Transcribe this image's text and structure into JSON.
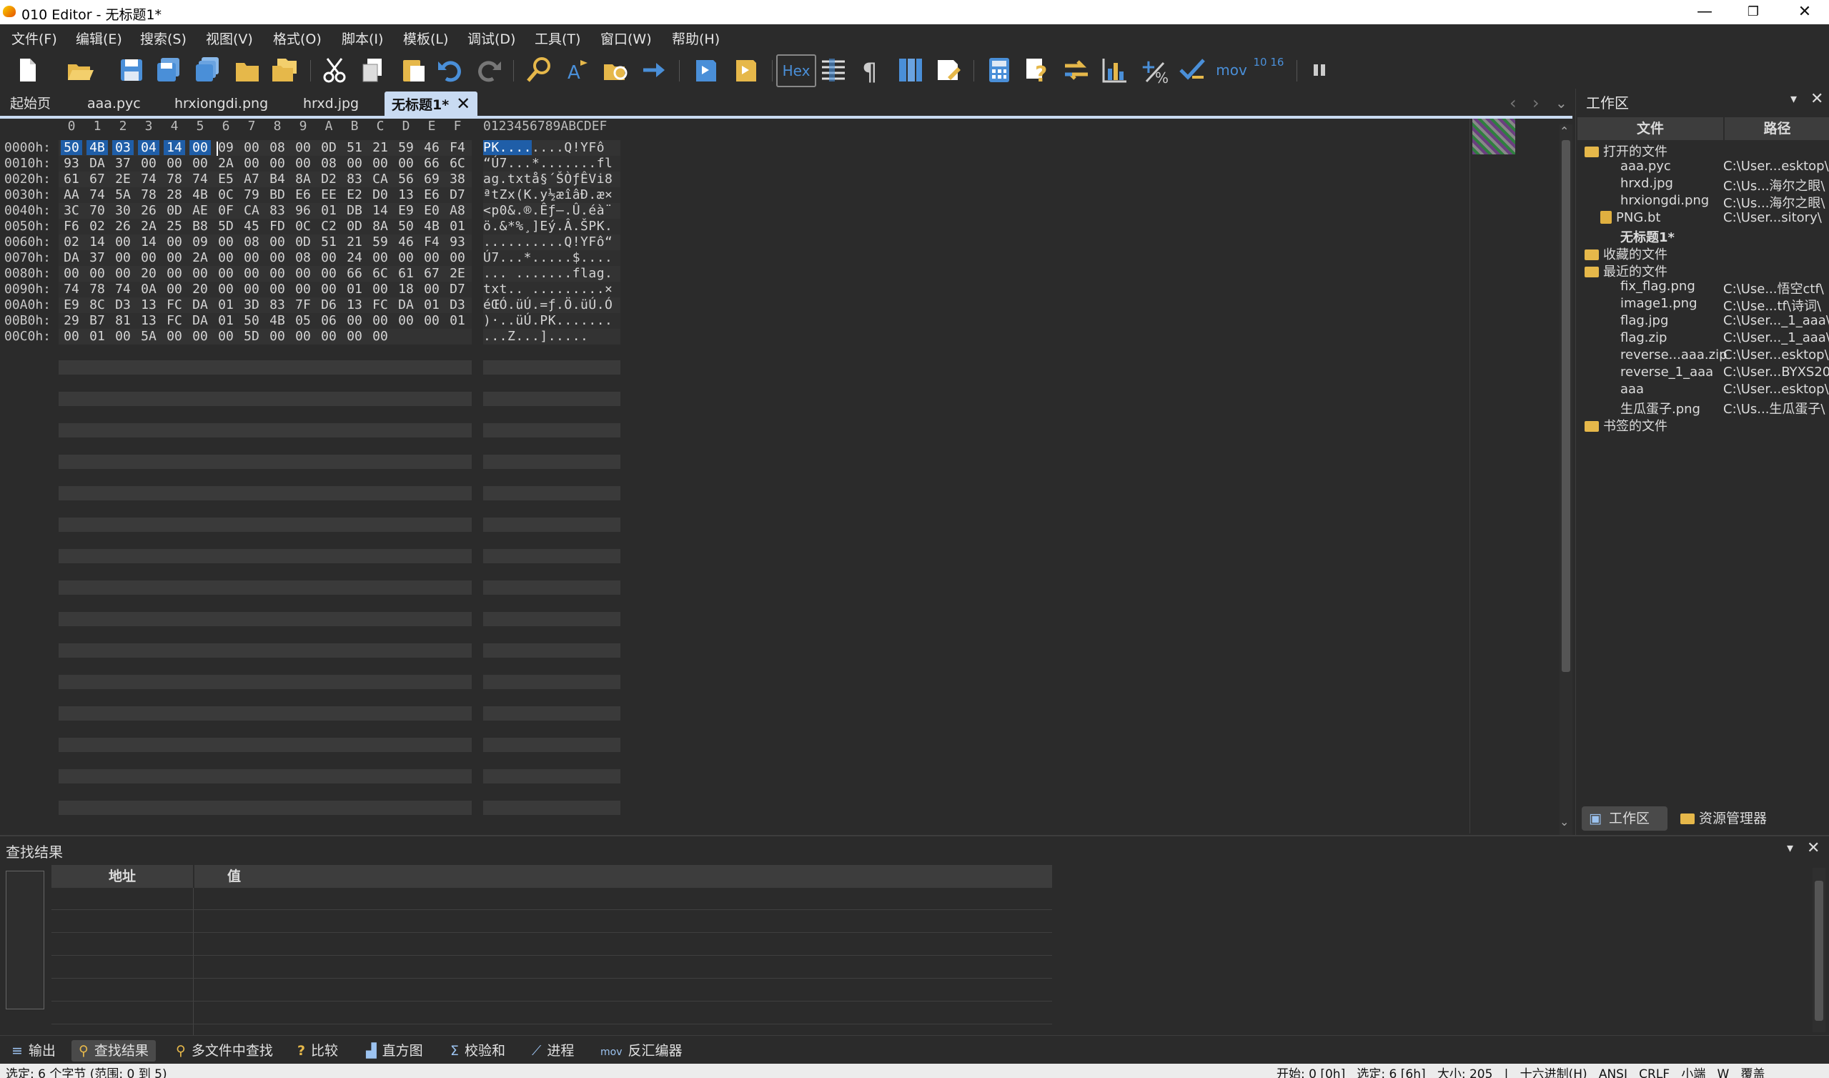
{
  "window": {
    "title": "010 Editor - 无标题1*",
    "minimize": "—",
    "maximize": "❐",
    "close": "✕"
  },
  "menu": [
    "文件(F)",
    "编辑(E)",
    "搜索(S)",
    "视图(V)",
    "格式(O)",
    "脚本(I)",
    "模板(L)",
    "调试(D)",
    "工具(T)",
    "窗口(W)",
    "帮助(H)"
  ],
  "toolbar": {
    "hex_label": "Hex",
    "mov_label": "mov",
    "base_label": "10 16"
  },
  "tabs": [
    "起始页",
    "aaa.pyc",
    "hrxiongdi.png",
    "hrxd.jpg",
    "无标题1*"
  ],
  "hex": {
    "column_headers": [
      "0",
      "1",
      "2",
      "3",
      "4",
      "5",
      "6",
      "7",
      "8",
      "9",
      "A",
      "B",
      "C",
      "D",
      "E",
      "F"
    ],
    "ascii_header": "0123456789ABCDEF",
    "rows": [
      {
        "addr": "0000h:",
        "bytes": [
          "50",
          "4B",
          "03",
          "04",
          "14",
          "00",
          "09",
          "00",
          "08",
          "00",
          "0D",
          "51",
          "21",
          "59",
          "46",
          "F4"
        ],
        "ascii": "PK........Q!YFô"
      },
      {
        "addr": "0010h:",
        "bytes": [
          "93",
          "DA",
          "37",
          "00",
          "00",
          "00",
          "2A",
          "00",
          "00",
          "00",
          "08",
          "00",
          "00",
          "00",
          "66",
          "6C"
        ],
        "ascii": "“Ú7...*.......fl"
      },
      {
        "addr": "0020h:",
        "bytes": [
          "61",
          "67",
          "2E",
          "74",
          "78",
          "74",
          "E5",
          "A7",
          "B4",
          "8A",
          "D2",
          "83",
          "CA",
          "56",
          "69",
          "38"
        ],
        "ascii": "ag.txtå§´ŠÒƒÊVi8"
      },
      {
        "addr": "0030h:",
        "bytes": [
          "AA",
          "74",
          "5A",
          "78",
          "28",
          "4B",
          "0C",
          "79",
          "BD",
          "E6",
          "EE",
          "E2",
          "D0",
          "13",
          "E6",
          "D7"
        ],
        "ascii": "ªtZx(K.y½æîâÐ.æ×"
      },
      {
        "addr": "0040h:",
        "bytes": [
          "3C",
          "70",
          "30",
          "26",
          "0D",
          "AE",
          "0F",
          "CA",
          "83",
          "96",
          "01",
          "DB",
          "14",
          "E9",
          "E0",
          "A8"
        ],
        "ascii": "<p0&.®.Êƒ–.Û.éà¨"
      },
      {
        "addr": "0050h:",
        "bytes": [
          "F6",
          "02",
          "26",
          "2A",
          "25",
          "B8",
          "5D",
          "45",
          "FD",
          "0C",
          "C2",
          "0D",
          "8A",
          "50",
          "4B",
          "01"
        ],
        "ascii": "ö.&*%¸]Eý.Â.ŠPK."
      },
      {
        "addr": "0060h:",
        "bytes": [
          "02",
          "14",
          "00",
          "14",
          "00",
          "09",
          "00",
          "08",
          "00",
          "0D",
          "51",
          "21",
          "59",
          "46",
          "F4",
          "93"
        ],
        "ascii": "..........Q!YFô“"
      },
      {
        "addr": "0070h:",
        "bytes": [
          "DA",
          "37",
          "00",
          "00",
          "00",
          "2A",
          "00",
          "00",
          "00",
          "08",
          "00",
          "24",
          "00",
          "00",
          "00",
          "00"
        ],
        "ascii": "Ú7...*.....$...."
      },
      {
        "addr": "0080h:",
        "bytes": [
          "00",
          "00",
          "00",
          "20",
          "00",
          "00",
          "00",
          "00",
          "00",
          "00",
          "00",
          "66",
          "6C",
          "61",
          "67",
          "2E"
        ],
        "ascii": "... .......flag."
      },
      {
        "addr": "0090h:",
        "bytes": [
          "74",
          "78",
          "74",
          "0A",
          "00",
          "20",
          "00",
          "00",
          "00",
          "00",
          "00",
          "01",
          "00",
          "18",
          "00",
          "D7"
        ],
        "ascii": "txt.. .........×"
      },
      {
        "addr": "00A0h:",
        "bytes": [
          "E9",
          "8C",
          "D3",
          "13",
          "FC",
          "DA",
          "01",
          "3D",
          "83",
          "7F",
          "D6",
          "13",
          "FC",
          "DA",
          "01",
          "D3"
        ],
        "ascii": "éŒÓ.üÚ.=ƒ.Ö.üÚ.Ó"
      },
      {
        "addr": "00B0h:",
        "bytes": [
          "29",
          "B7",
          "81",
          "13",
          "FC",
          "DA",
          "01",
          "50",
          "4B",
          "05",
          "06",
          "00",
          "00",
          "00",
          "00",
          "01"
        ],
        "ascii": ")·..üÚ.PK......."
      },
      {
        "addr": "00C0h:",
        "bytes": [
          "00",
          "01",
          "00",
          "5A",
          "00",
          "00",
          "00",
          "5D",
          "00",
          "00",
          "00",
          "00",
          "00"
        ],
        "ascii": "...Z...]....."
      }
    ]
  },
  "workspace": {
    "title": "工作区",
    "col_file": "文件",
    "col_path": "路径",
    "open_files_label": "打开的文件",
    "open_files": [
      {
        "name": "aaa.pyc",
        "path": "C:\\User...esktop\\"
      },
      {
        "name": "hrxd.jpg",
        "path": "C:\\Us...海尔之眼\\"
      },
      {
        "name": "hrxiongdi.png",
        "path": "C:\\Us...海尔之眼\\"
      },
      {
        "name": "PNG.bt",
        "path": "C:\\User...sitory\\"
      },
      {
        "name": "无标题1*",
        "path": ""
      }
    ],
    "favorites_label": "收藏的文件",
    "recent_label": "最近的文件",
    "recent_files": [
      {
        "name": "fix_flag.png",
        "path": "C:\\Use...悟空ctf\\"
      },
      {
        "name": "image1.png",
        "path": "C:\\Use...tf\\诗词\\"
      },
      {
        "name": "flag.jpg",
        "path": "C:\\User..._1_aaa\\"
      },
      {
        "name": "flag.zip",
        "path": "C:\\User..._1_aaa\\"
      },
      {
        "name": "reverse...aaa.zip",
        "path": "C:\\User...esktop\\"
      },
      {
        "name": "reverse_1_aaa",
        "path": "C:\\User...BYXS20\\"
      },
      {
        "name": "aaa",
        "path": "C:\\User...esktop\\"
      },
      {
        "name": "生瓜蛋子.png",
        "path": "C:\\Us...生瓜蛋子\\"
      }
    ],
    "bookmarks_label": "书签的文件",
    "tab_workspace": "工作区",
    "tab_explorer": "资源管理器"
  },
  "find": {
    "title": "查找结果",
    "col_address": "地址",
    "col_value": "值"
  },
  "bottom_tabs": [
    "输出",
    "查找结果",
    "多文件中查找",
    "比较",
    "直方图",
    "校验和",
    "进程",
    "反汇编器"
  ],
  "status": {
    "left": "选定: 6 个字节 (范围: 0 到 5)",
    "right": "开始: 0 [0h]   选定: 6 [6h]   大小: 205   |   十六进制(H)   ANSI   CRLF   小端   W   覆盖"
  },
  "colors": {
    "accent": "#1f5ea8",
    "tab_active": "#c9dbf2",
    "folder": "#e6b84a",
    "background": "#2b2b2b"
  }
}
